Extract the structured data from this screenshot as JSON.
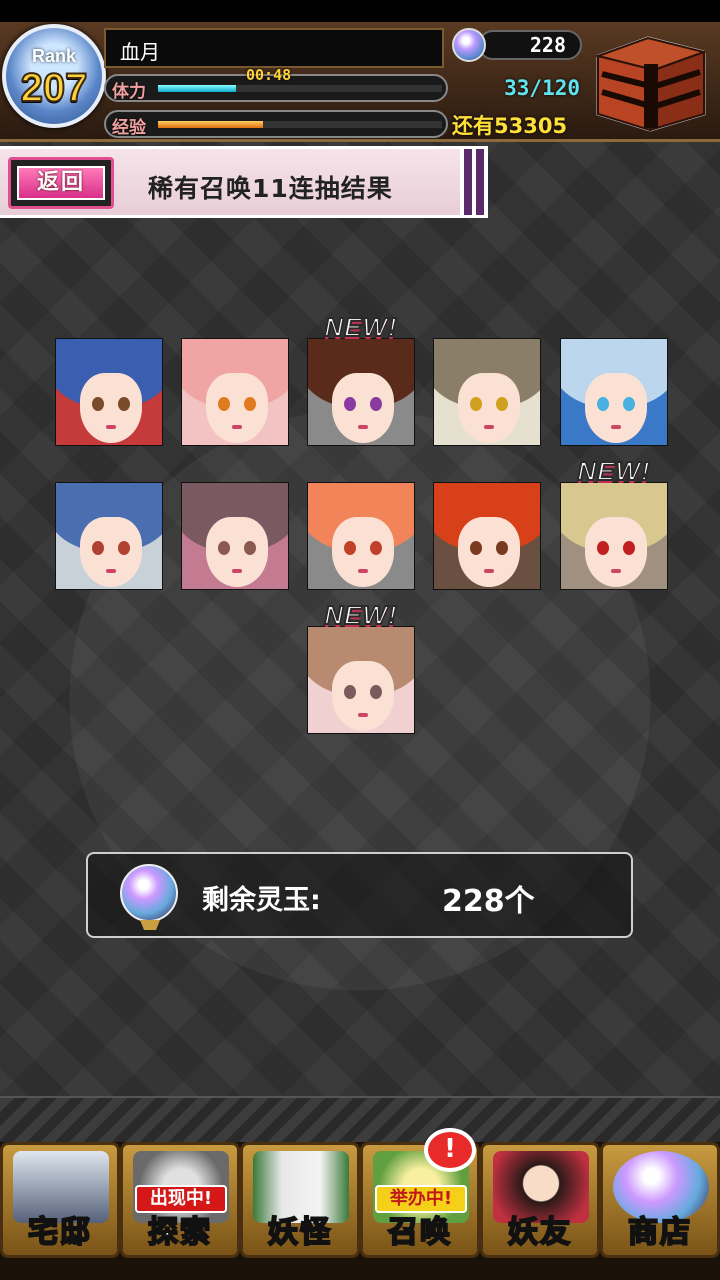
{
  "player": {
    "rank_label": "Rank",
    "rank": "207",
    "name": "血月",
    "stamina_label": "体力",
    "stamina_timer": "00:48",
    "stamina_value": "33/120",
    "stamina_fraction": 0.275,
    "exp_label": "经验",
    "exp_fraction": 0.37,
    "exp_remaining": "还有53305",
    "gems": "228"
  },
  "title_bar": {
    "back_label": "返回",
    "title": "稀有召唤11连抽结果"
  },
  "results": {
    "new_label": "NEW!",
    "cards": [
      {
        "hair": "#3a5fb0",
        "eye": "#7a4a2a",
        "bg": "#c53a3a",
        "is_new": false
      },
      {
        "hair": "#f0a4a4",
        "eye": "#e07a20",
        "bg": "#f3c2c2",
        "is_new": false
      },
      {
        "hair": "#5a2a1a",
        "eye": "#8a3aa0",
        "bg": "#8a8a8a",
        "is_new": true
      },
      {
        "hair": "#8a7e68",
        "eye": "#d0a020",
        "bg": "#e6e0d0",
        "is_new": false
      },
      {
        "hair": "#bcd6ee",
        "eye": "#4ab0e0",
        "bg": "#3a78c8",
        "is_new": false
      },
      {
        "hair": "#4a6eb0",
        "eye": "#b04030",
        "bg": "#c8d0d8",
        "is_new": false
      },
      {
        "hair": "#7a5a60",
        "eye": "#8a5a50",
        "bg": "#c47a90",
        "is_new": false
      },
      {
        "hair": "#f2845a",
        "eye": "#c0402a",
        "bg": "#8a8a8a",
        "is_new": false
      },
      {
        "hair": "#d8401a",
        "eye": "#7a3a20",
        "bg": "#6a5040",
        "is_new": false
      },
      {
        "hair": "#d8c890",
        "eye": "#c02020",
        "bg": "#a09080",
        "is_new": true
      },
      {
        "hair": "#b88a70",
        "eye": "#7a5a5a",
        "bg": "#f0d0d0",
        "is_new": true
      }
    ]
  },
  "remaining": {
    "label": "剩余灵玉:",
    "value": "228个"
  },
  "nav": {
    "items": [
      {
        "label": "宅邸",
        "tag": ""
      },
      {
        "label": "探索",
        "tag": "出现中!"
      },
      {
        "label": "妖怪",
        "tag": ""
      },
      {
        "label": "召唤",
        "tag": "举办中!"
      },
      {
        "label": "妖友",
        "tag": ""
      },
      {
        "label": "商店",
        "tag": ""
      }
    ],
    "alert": "!"
  }
}
